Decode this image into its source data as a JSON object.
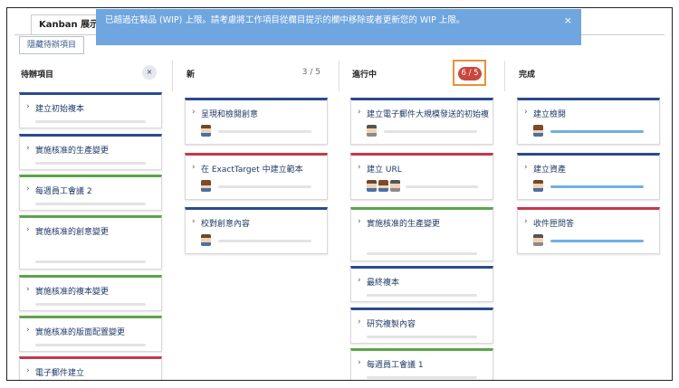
{
  "tab_label": "Kanban 展示板",
  "hide_button": "隱藏待辦項目",
  "banner": {
    "message": "已超過在製品 (WIP) 上限。請考慮將工作項目從欄目提示的欄中移除或者更新您的 WIP 上限。",
    "close": "×"
  },
  "columns": {
    "backlog": {
      "title": "待辦項目",
      "clear": "×",
      "cards": [
        {
          "title": "建立初始複本",
          "color": "blue"
        },
        {
          "title": "實施核准的生產變更",
          "color": "blue"
        },
        {
          "title": "每週員工會議 2",
          "color": "green"
        },
        {
          "title": "實施核准的創意變更",
          "color": "green"
        },
        {
          "title": "實施核准的複本變更",
          "color": "green"
        },
        {
          "title": "實施核准的版面配置變更",
          "color": "green"
        },
        {
          "title": "電子郵件建立",
          "color": "red"
        }
      ]
    },
    "new": {
      "title": "新",
      "count": "3 / 5",
      "cards": [
        {
          "title": "呈現和檢閱創意",
          "color": "blue"
        },
        {
          "title": "在 ExactTarget 中建立範本",
          "color": "red"
        },
        {
          "title": "校對創意內容",
          "color": "blue"
        }
      ]
    },
    "in_progress": {
      "title": "進行中",
      "wip": "6 / 5",
      "cards": [
        {
          "title": "建立電子郵件大規模發送的初始複本",
          "color": "blue"
        },
        {
          "title": "建立 URL",
          "color": "red"
        },
        {
          "title": "實施核准的生產變更",
          "color": "green"
        },
        {
          "title": "最終複本",
          "color": "blue"
        },
        {
          "title": "研究複製內容",
          "color": "blue"
        },
        {
          "title": "每週員工會議 1",
          "color": "green"
        }
      ]
    },
    "done": {
      "title": "完成",
      "cards": [
        {
          "title": "建立檢閱",
          "color": "blue"
        },
        {
          "title": "建立資產",
          "color": "blue"
        },
        {
          "title": "收件匣問答",
          "color": "red"
        }
      ]
    }
  },
  "colors": {
    "banner": "#6fa6df",
    "wip_exceeded": "#c9473f",
    "wip_highlight": "#e8913a",
    "card_blue": "#2c4a8f",
    "card_green": "#5aa54a",
    "card_red": "#c4384c"
  }
}
